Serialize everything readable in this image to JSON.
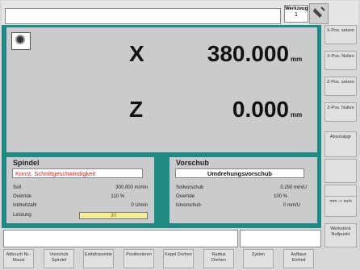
{
  "header": {
    "tool_label": "Werkzeug",
    "tool_number": "1"
  },
  "axes": [
    {
      "name": "X",
      "value": "380.000",
      "unit": "mm"
    },
    {
      "name": "Z",
      "value": "0.000",
      "unit": "mm"
    }
  ],
  "spindle": {
    "title": "Spindel",
    "mode": "Konst. Schnittgeschwindigkeit",
    "rows": [
      {
        "label": "Soll",
        "value": "300.000 m/min"
      },
      {
        "label": "Override",
        "value": "110 %"
      },
      {
        "label": "Istdrehzahl",
        "value": "0 U/min"
      },
      {
        "label": "Leistung",
        "value": "30"
      }
    ]
  },
  "feed": {
    "title": "Vorschub",
    "mode": "Umdrehungsvorschub",
    "rows": [
      {
        "label": "Sollvorschub",
        "value": "0.250 mm/U"
      },
      {
        "label": "Override",
        "value": "100 %"
      },
      {
        "label": "Istvorschub",
        "value": "0 mm/U"
      }
    ]
  },
  "right_softkeys": [
    "X-Pos. setzen",
    "X-Pos. Nullen",
    "Z-Pos. setzen",
    "Z-Pos. Nullen",
    "Absolutpgr",
    "",
    "",
    "mm -> inch",
    "Werkstück Nullpunkt"
  ],
  "bottom_softkeys": [
    "Abbruch Nr.-Maust",
    "Vorschub Spindel",
    "Einfahrpunkte",
    "Positionieren",
    "Kegel Drehen",
    "Radius Drehen",
    "Zyklen",
    "Aufbaur Einheit"
  ]
}
